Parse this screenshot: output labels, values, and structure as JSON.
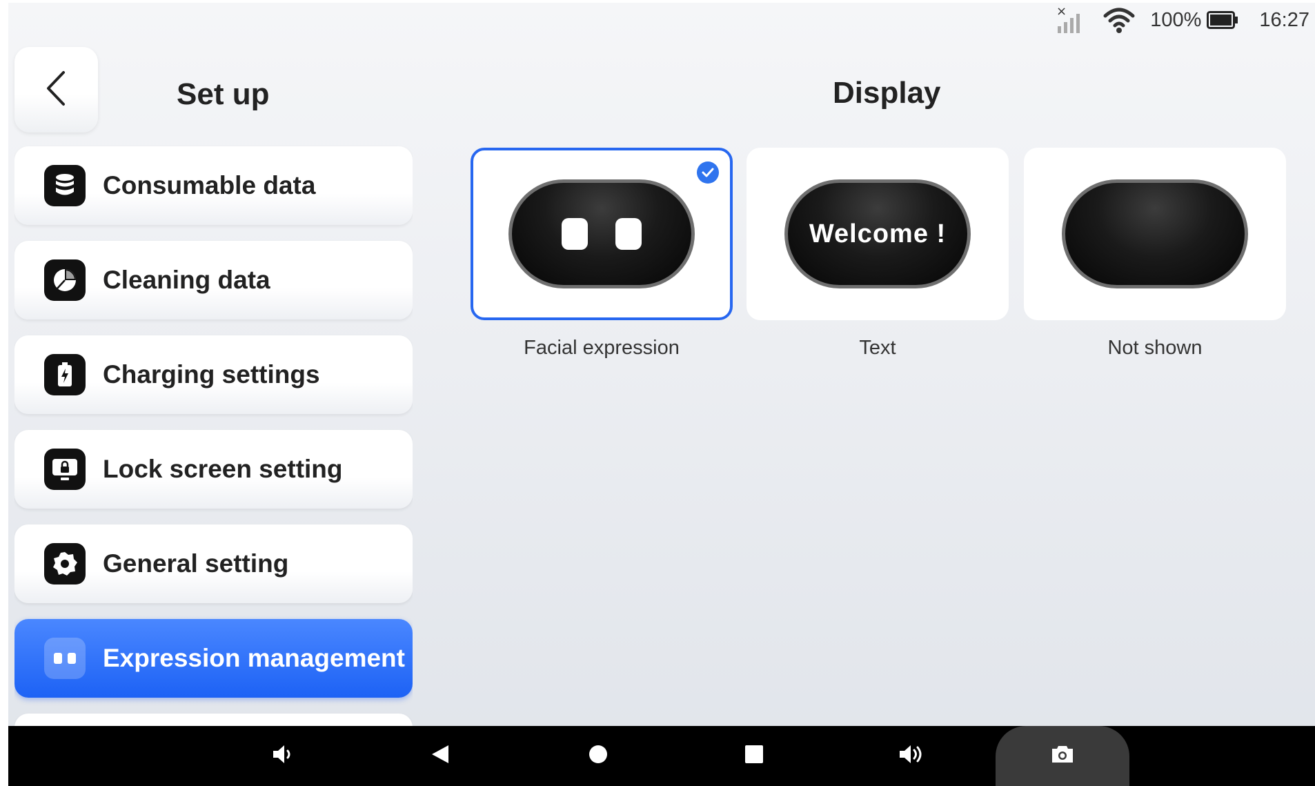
{
  "status_bar": {
    "signal_icon": "no-signal-icon",
    "wifi_icon": "wifi-icon",
    "battery_percent": "100%",
    "battery_icon": "battery-full-icon",
    "time": "16:27"
  },
  "header": {
    "back_icon": "chevron-left-icon",
    "setup_title": "Set up",
    "display_title": "Display"
  },
  "sidebar": {
    "items": [
      {
        "label": "Consumable data",
        "icon": "database-icon"
      },
      {
        "label": "Cleaning data",
        "icon": "pie-chart-icon"
      },
      {
        "label": "Charging settings",
        "icon": "battery-charging-icon"
      },
      {
        "label": "Lock screen setting",
        "icon": "lock-screen-icon"
      },
      {
        "label": "General setting",
        "icon": "gear-icon"
      },
      {
        "label": "Expression management",
        "icon": "expression-eyes-icon",
        "active": true
      }
    ]
  },
  "display_options": [
    {
      "label": "Facial expression",
      "preview": "eyes",
      "selected": true
    },
    {
      "label": "Text",
      "preview_text": "Welcome !",
      "selected": false
    },
    {
      "label": "Not shown",
      "preview": "blank",
      "selected": false
    }
  ],
  "nav_bar": {
    "buttons": [
      "volume-down-icon",
      "back-triangle-icon",
      "home-circle-icon",
      "recents-square-icon",
      "volume-up-icon",
      "camera-icon"
    ]
  },
  "colors": {
    "accent": "#1d62f5",
    "selected_border": "#2767f0",
    "background": "#eceef2"
  }
}
